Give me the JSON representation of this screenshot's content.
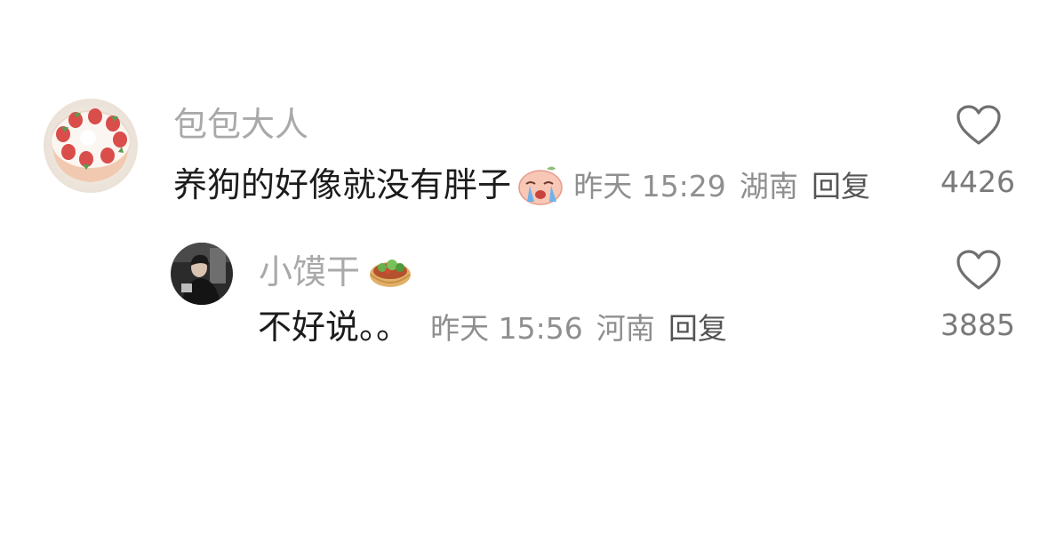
{
  "comments": [
    {
      "author": "包包大人",
      "content": "养狗的好像就没有胖子",
      "emoji": "crying-face-emoji",
      "time": "昨天 15:29",
      "location": "湖南",
      "reply_label": "回复",
      "likes": "4426",
      "avatar_icon": "strawberry-cake-avatar"
    },
    {
      "author": "小馍干",
      "author_badge": "pita-sandwich-emoji",
      "content": "不好说。。",
      "time": "昨天 15:56",
      "location": "河南",
      "reply_label": "回复",
      "likes": "3885",
      "avatar_icon": "person-photo-avatar"
    }
  ],
  "colors": {
    "author": "#a9a9a9",
    "content": "#1c1c1c",
    "meta": "#8f8f8f",
    "reply": "#555555",
    "like_icon": "#707070",
    "like_count": "#7a7a7a"
  }
}
